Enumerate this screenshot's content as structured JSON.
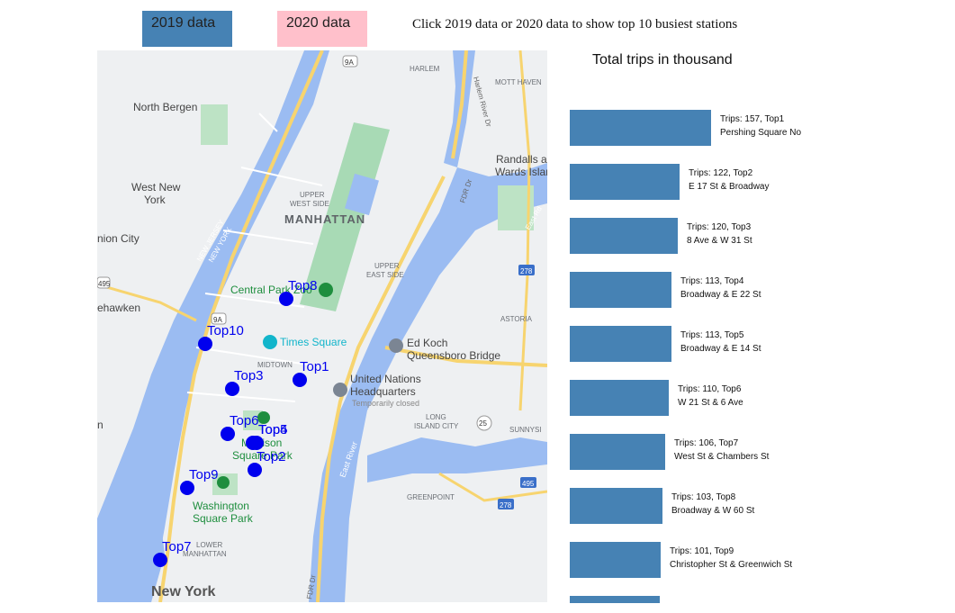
{
  "controls": {
    "btn_2019": "2019 data",
    "btn_2020": "2020 data",
    "btn_2019_color": "#4682b4",
    "btn_2020_color": "#ffc0cb",
    "instruction": "Click 2019 data or 2020 data to show top 10 busiest stations"
  },
  "map": {
    "labels": {
      "north_bergen": "North Bergen",
      "west_new_york_1": "West New",
      "west_new_york_2": "York",
      "union_city": "nion City",
      "hoboken": "ehawken",
      "manhattan": "MANHATTAN",
      "upper_west_side_1": "UPPER",
      "upper_west_side_2": "WEST SIDE",
      "upper_east_side_1": "UPPER",
      "upper_east_side_2": "EAST SIDE",
      "harlem": "HARLEM",
      "mott_haven": "MOTT HAVEN",
      "randalls_1": "Randalls a",
      "randalls_2": "Wards Islan",
      "astoria": "ASTORIA",
      "central_park": "Central Park Zoo",
      "times_square": "Times Square",
      "midtown": "MIDTOWN",
      "ed_koch_1": "Ed Koch",
      "ed_koch_2": "Queensboro Bridge",
      "un_1": "United Nations",
      "un_2": "Headquarters",
      "un_3": "Temporarily closed",
      "long_island_city_1": "LONG",
      "long_island_city_2": "ISLAND CITY",
      "madison_1": "Madison",
      "madison_2": "Square Park",
      "washington_1": "Washington",
      "washington_2": "Square Park",
      "greenpoint": "GREENPOINT",
      "lower_manhattan_1": "LOWER",
      "lower_manhattan_2": "MANHATTAN",
      "new_york": "New York",
      "sunnyside": "SUNNYSI",
      "nj_1": "NEW JERSEY",
      "nj_2": "NEW YORK",
      "fdr_1": "FDR Dr",
      "fdr_2": "FDR Dr",
      "east_river": "East River",
      "harlem_river": "Harlem River Dr",
      "shield_9a_1": "9A",
      "shield_9a_2": "9A",
      "shield_278_1": "278",
      "shield_278_2": "278",
      "shield_495": "495",
      "shield_25": "25",
      "shield_495b": "495",
      "shield_95": "95",
      "east_rd": "East Rd",
      "n": "n"
    },
    "stations": [
      {
        "label": "Top1"
      },
      {
        "label": "Top2"
      },
      {
        "label": "Top3"
      },
      {
        "label": "Top4"
      },
      {
        "label": "Top5"
      },
      {
        "label": "Top6"
      },
      {
        "label": "Top7"
      },
      {
        "label": "Top8"
      },
      {
        "label": "Top9"
      },
      {
        "label": "Top10"
      }
    ],
    "marker_color": "#0000ee"
  },
  "chart_data": {
    "type": "bar",
    "title": "Total trips in thousand",
    "bar_color": "#4682b4",
    "categories": [
      "Top1",
      "Top2",
      "Top3",
      "Top4",
      "Top5",
      "Top6",
      "Top7",
      "Top8",
      "Top9",
      "Top10"
    ],
    "stations": [
      "Pershing Square No",
      "E 17 St & Broadway",
      "8 Ave & W 31 St",
      "Broadway & E 22 St",
      "Broadway & E 14 St",
      "W 21 St & 6 Ave",
      "West St & Chambers St",
      "Broadway & W 60 St",
      "Christopher St & Greenwich St",
      ""
    ],
    "values": [
      157,
      122,
      120,
      113,
      113,
      110,
      106,
      103,
      101,
      100
    ],
    "labels": [
      "Trips: 157, Top1",
      "Trips: 122, Top2",
      "Trips: 120, Top3",
      "Trips: 113, Top4",
      "Trips: 113, Top5",
      "Trips: 110, Top6",
      "Trips: 106, Top7",
      "Trips: 103, Top8",
      "Trips: 101, Top9",
      ""
    ]
  }
}
